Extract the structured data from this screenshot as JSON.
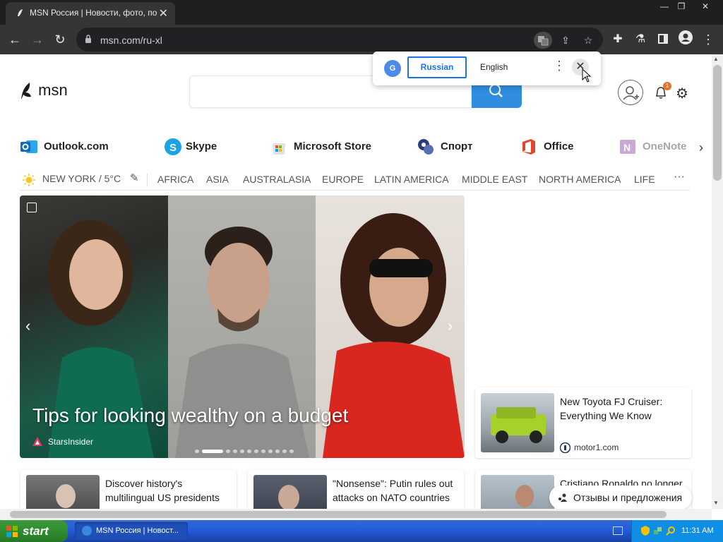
{
  "browser": {
    "tab_title": "MSN Россия | Новости, фото, пого",
    "tab_close": "✕",
    "url": "msn.com/ru-xl",
    "window_controls": {
      "minimize": "—",
      "restore": "❐",
      "close": "✕"
    },
    "back": "←",
    "forward": "→",
    "reload": "↻",
    "extensions": [
      "translate-icon",
      "share-icon",
      "star-icon",
      "puzzle-icon",
      "flask-icon",
      "sidepanel-icon",
      "profile-icon",
      "menu-icon"
    ]
  },
  "translate_popup": {
    "logo": "G",
    "source_lang": "Russian",
    "target_lang": "English",
    "more": "⋮",
    "close": "✕"
  },
  "msn": {
    "logo_text": "msn",
    "search_placeholder": "",
    "notification_count": "1",
    "settings": "⚙"
  },
  "quick_links": [
    {
      "label": "Outlook.com",
      "color": "#0f6cbd"
    },
    {
      "label": "Skype",
      "color": "#1aa3e5"
    },
    {
      "label": "Microsoft Store",
      "color": "#777777"
    },
    {
      "label": "Спорт",
      "color": "#2a3d7a"
    },
    {
      "label": "Office",
      "color": "#e2472b"
    },
    {
      "label": "OneNote",
      "color": "#7a2b9c"
    }
  ],
  "weather": {
    "location": "NEW YORK / 5°C"
  },
  "regions": [
    "AFRICA",
    "ASIA",
    "AUSTRALASIA",
    "EUROPE",
    "LATIN AMERICA",
    "MIDDLE EAST",
    "NORTH AMERICA",
    "LIFE"
  ],
  "regions_more": "···",
  "hero": {
    "title": "Tips for looking wealthy on a budget",
    "source": "StarsInsider",
    "slide_count": 12,
    "active_slide": 2
  },
  "cards": [
    {
      "title": "New Toyota FJ Cruiser: Everything We Know",
      "source": "motor1.com"
    },
    {
      "title": "Discover history's multilingual US presidents",
      "source": ""
    },
    {
      "title": "\"Nonsense\": Putin rules out attacks on NATO countries",
      "source": ""
    },
    {
      "title": "Cristiano Ronaldo no longer",
      "source": ""
    }
  ],
  "feedback": {
    "label": "Отзывы и предложения"
  },
  "taskbar": {
    "start": "start",
    "task_title": "MSN Россия | Новост...",
    "clock": "11:31 AM"
  }
}
